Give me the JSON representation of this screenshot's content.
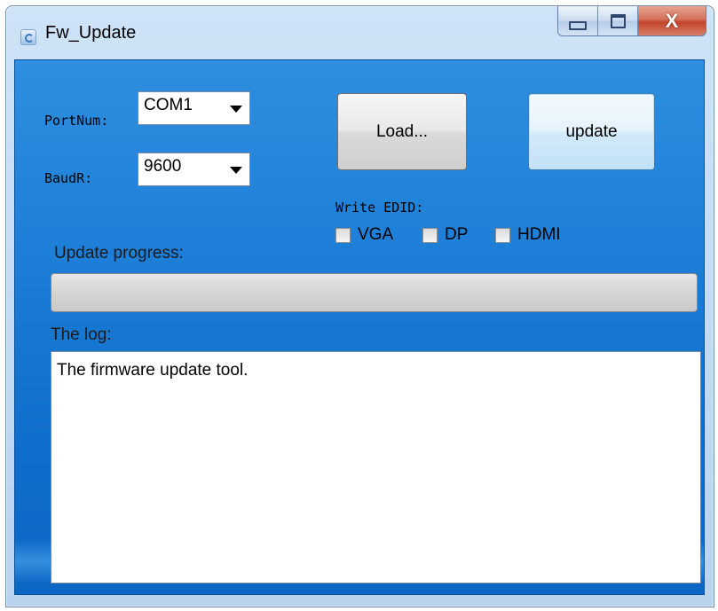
{
  "window": {
    "title": "Fw_Update"
  },
  "caption_buttons": {
    "minimize_icon": "minimize-icon",
    "maximize_icon": "maximize-icon",
    "close_glyph": "X"
  },
  "port": {
    "label": "PortNum:",
    "value": "COM1"
  },
  "baud": {
    "label": "BaudR:",
    "value": "9600"
  },
  "buttons": {
    "load": "Load...",
    "update": "update"
  },
  "edid": {
    "label": "Write EDID:",
    "options": [
      {
        "label": "VGA",
        "checked": false
      },
      {
        "label": "DP",
        "checked": false
      },
      {
        "label": "HDMI",
        "checked": false
      }
    ]
  },
  "progress": {
    "label": "Update progress:",
    "value_percent": 0
  },
  "log": {
    "label": "The log:",
    "text": "The firmware update tool."
  },
  "colors": {
    "client_bg": "#1d7fd7",
    "close_button": "#c4432a"
  }
}
